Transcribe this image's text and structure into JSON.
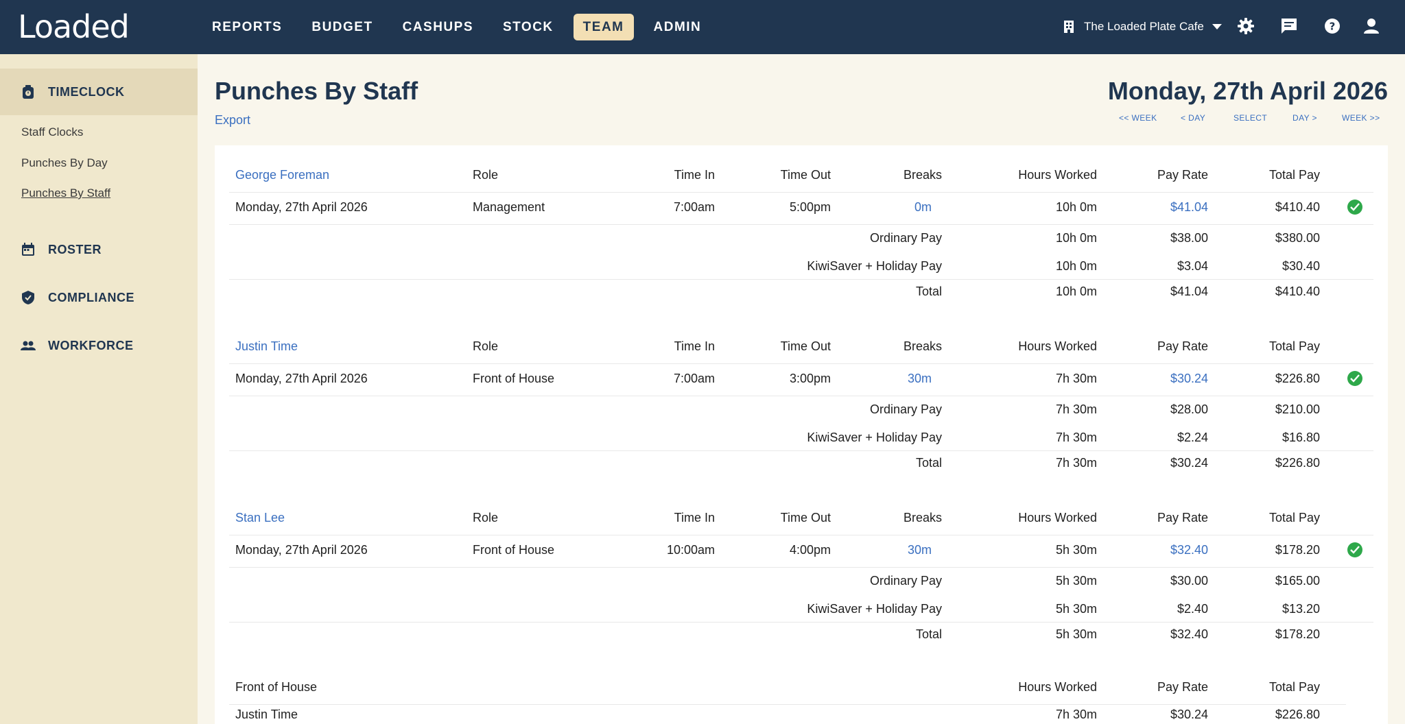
{
  "app": {
    "logo": "Loaded"
  },
  "nav": {
    "items": [
      "REPORTS",
      "BUDGET",
      "CASHUPS",
      "STOCK",
      "TEAM",
      "ADMIN"
    ],
    "active": "TEAM"
  },
  "venue": {
    "name": "The Loaded Plate Cafe"
  },
  "sidebar": {
    "timeclock": "TIMECLOCK",
    "links": [
      "Staff Clocks",
      "Punches By Day",
      "Punches By Staff"
    ],
    "roster": "ROSTER",
    "compliance": "COMPLIANCE",
    "workforce": "WORKFORCE"
  },
  "page": {
    "title": "Punches By Staff",
    "export": "Export",
    "date": "Monday, 27th April 2026",
    "date_nav": [
      "<< WEEK",
      "< DAY",
      "SELECT",
      "DAY >",
      "WEEK >>"
    ]
  },
  "headers": {
    "role": "Role",
    "time_in": "Time In",
    "time_out": "Time Out",
    "breaks": "Breaks",
    "hours": "Hours Worked",
    "rate": "Pay Rate",
    "total": "Total Pay"
  },
  "staff": [
    {
      "name": "George Foreman",
      "date": "Monday, 27th April 2026",
      "role": "Management",
      "time_in": "7:00am",
      "time_out": "5:00pm",
      "breaks": "0m",
      "hours": "10h 0m",
      "rate": "$41.04",
      "total": "$410.40",
      "ordinary_label": "Ordinary Pay",
      "ordinary_hours": "10h 0m",
      "ordinary_rate": "$38.00",
      "ordinary_total": "$380.00",
      "kiwi_label": "KiwiSaver + Holiday Pay",
      "kiwi_hours": "10h 0m",
      "kiwi_rate": "$3.04",
      "kiwi_total": "$30.40",
      "sum_label": "Total",
      "sum_hours": "10h 0m",
      "sum_rate": "$41.04",
      "sum_total": "$410.40"
    },
    {
      "name": "Justin Time",
      "date": "Monday, 27th April 2026",
      "role": "Front of House",
      "time_in": "7:00am",
      "time_out": "3:00pm",
      "breaks": "30m",
      "hours": "7h 30m",
      "rate": "$30.24",
      "total": "$226.80",
      "ordinary_label": "Ordinary Pay",
      "ordinary_hours": "7h 30m",
      "ordinary_rate": "$28.00",
      "ordinary_total": "$210.00",
      "kiwi_label": "KiwiSaver + Holiday Pay",
      "kiwi_hours": "7h 30m",
      "kiwi_rate": "$2.24",
      "kiwi_total": "$16.80",
      "sum_label": "Total",
      "sum_hours": "7h 30m",
      "sum_rate": "$30.24",
      "sum_total": "$226.80"
    },
    {
      "name": "Stan Lee",
      "date": "Monday, 27th April 2026",
      "role": "Front of House",
      "time_in": "10:00am",
      "time_out": "4:00pm",
      "breaks": "30m",
      "hours": "5h 30m",
      "rate": "$32.40",
      "total": "$178.20",
      "ordinary_label": "Ordinary Pay",
      "ordinary_hours": "5h 30m",
      "ordinary_rate": "$30.00",
      "ordinary_total": "$165.00",
      "kiwi_label": "KiwiSaver + Holiday Pay",
      "kiwi_hours": "5h 30m",
      "kiwi_rate": "$2.40",
      "kiwi_total": "$13.20",
      "sum_label": "Total",
      "sum_hours": "5h 30m",
      "sum_rate": "$32.40",
      "sum_total": "$178.20"
    }
  ],
  "role_summary": {
    "role": "Front of House",
    "rows": [
      {
        "name": "Justin Time",
        "hours": "7h 30m",
        "rate": "$30.24",
        "total": "$226.80"
      }
    ]
  },
  "colors": {
    "navy": "#203650",
    "accent": "#f3dfb4",
    "link": "#3a6fc0",
    "sidebar": "#f0e8cd",
    "check": "#2ea84a"
  },
  "icons": [
    "building-icon",
    "caret-down-icon",
    "gear-icon",
    "chat-icon",
    "help-icon",
    "user-icon",
    "timeclock-icon",
    "calendar-icon",
    "shield-icon",
    "people-icon",
    "check-circle-icon"
  ]
}
